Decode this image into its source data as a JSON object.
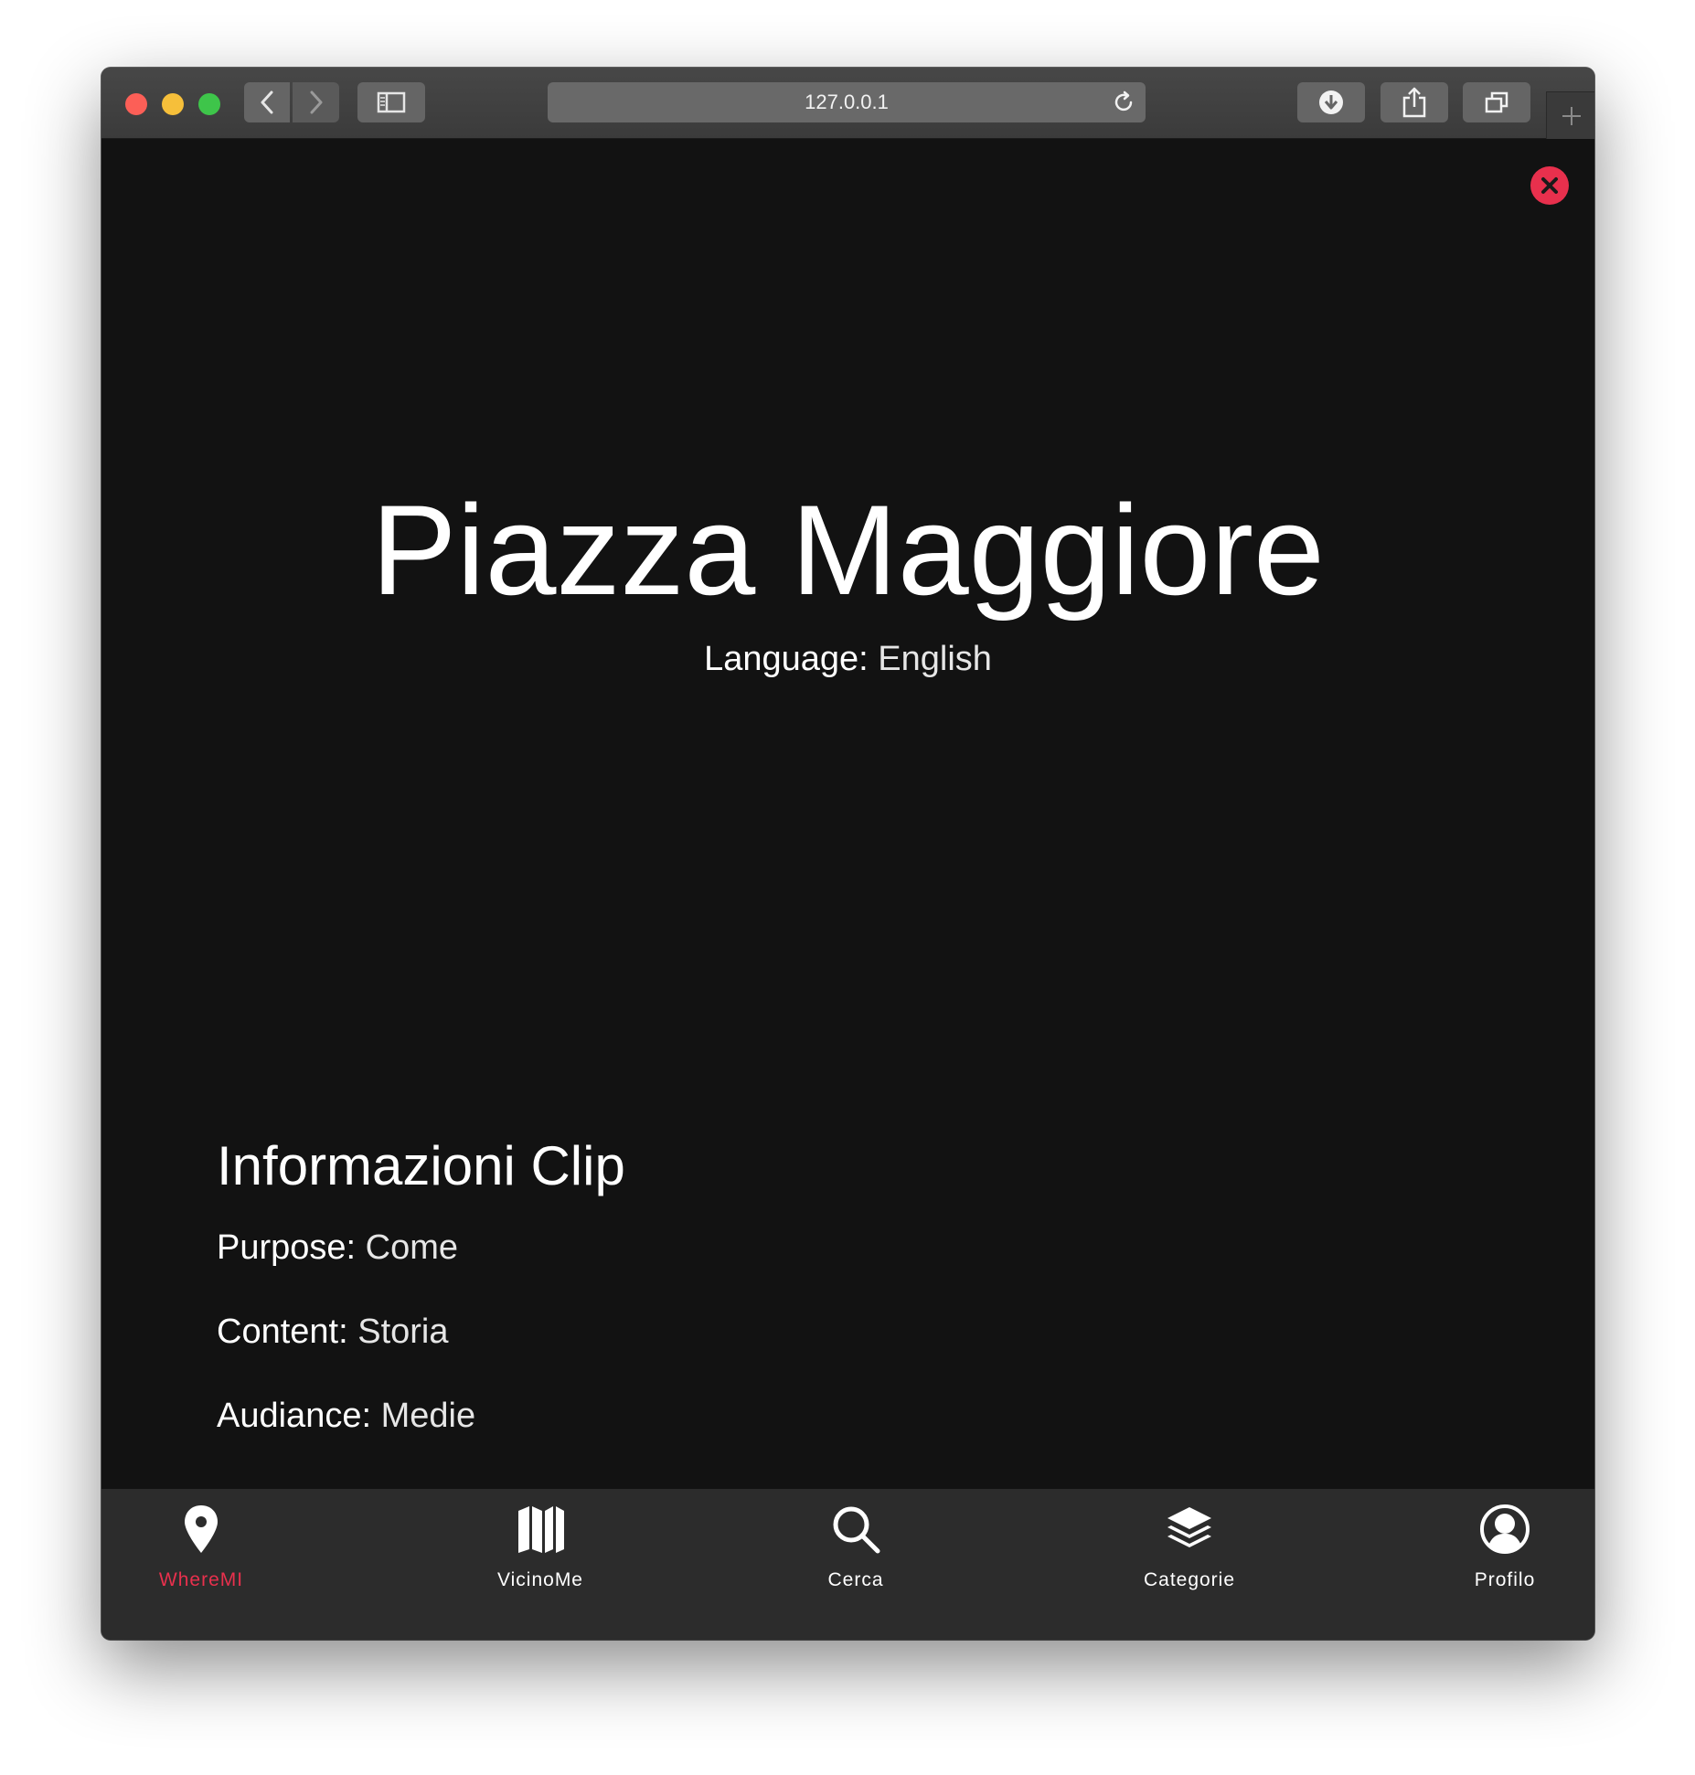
{
  "browser": {
    "url": "127.0.0.1"
  },
  "page": {
    "title": "Piazza Maggiore",
    "language_label": "Language:",
    "language_value": "English",
    "clip_heading": "Informazioni Clip",
    "purpose_label": "Purpose:",
    "purpose_value": "Come",
    "content_label": "Content:",
    "content_value": "Storia",
    "audiance_label": "Audiance:",
    "audiance_value": "Medie"
  },
  "tabbar": {
    "items": [
      {
        "label": "WhereMI",
        "icon": "map-pin-icon",
        "active": true
      },
      {
        "label": "VicinoMe",
        "icon": "map-icon",
        "active": false
      },
      {
        "label": "Cerca",
        "icon": "search-icon",
        "active": false
      },
      {
        "label": "Categorie",
        "icon": "layers-icon",
        "active": false
      },
      {
        "label": "Profilo",
        "icon": "user-circle-icon",
        "active": false
      }
    ]
  },
  "colors": {
    "accent": "#e8304d",
    "background": "#121212",
    "tabbar": "#2c2c2c"
  }
}
